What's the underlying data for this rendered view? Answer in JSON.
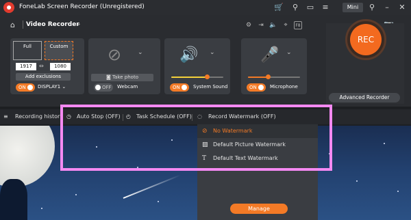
{
  "app": {
    "title": "FoneLab Screen Recorder (Unregistered)",
    "mini_label": "Mini"
  },
  "nav": {
    "title": "Video Recorder"
  },
  "display_card": {
    "full_label": "Full",
    "custom_label": "Custom",
    "width": "1917",
    "height": "1080",
    "add_exclusions_label": "Add exclusions",
    "toggle_label": "ON",
    "display_label": "DISPLAY1"
  },
  "webcam_card": {
    "take_photo_label": "Take photo",
    "toggle_label": "OFF",
    "label": "Webcam"
  },
  "system_sound_card": {
    "toggle_label": "ON",
    "label": "System Sound",
    "volume_level": 0.7
  },
  "microphone_card": {
    "toggle_label": "ON",
    "label": "Microphone",
    "volume_level": 0.4
  },
  "rec": {
    "label": "REC",
    "advanced_label": "Advanced Recorder"
  },
  "bottombar": {
    "history_label": "Recording history",
    "auto_stop_label": "Auto Stop (OFF)",
    "task_schedule_label": "Task Schedule (OFF)",
    "watermark_label": "Record Watermark (OFF)"
  },
  "dropdown": {
    "items": [
      {
        "label": "No Watermark",
        "icon": "no-entry-icon",
        "selected": true
      },
      {
        "label": "Default Picture Watermark",
        "icon": "picture-icon",
        "selected": false
      },
      {
        "label": "Default Text Watermark",
        "icon": "text-t-icon",
        "selected": false
      }
    ],
    "manage_label": "Manage"
  },
  "colors": {
    "accent": "#f37a26",
    "highlight": "#f489f2",
    "selected_text": "#f37a26"
  }
}
